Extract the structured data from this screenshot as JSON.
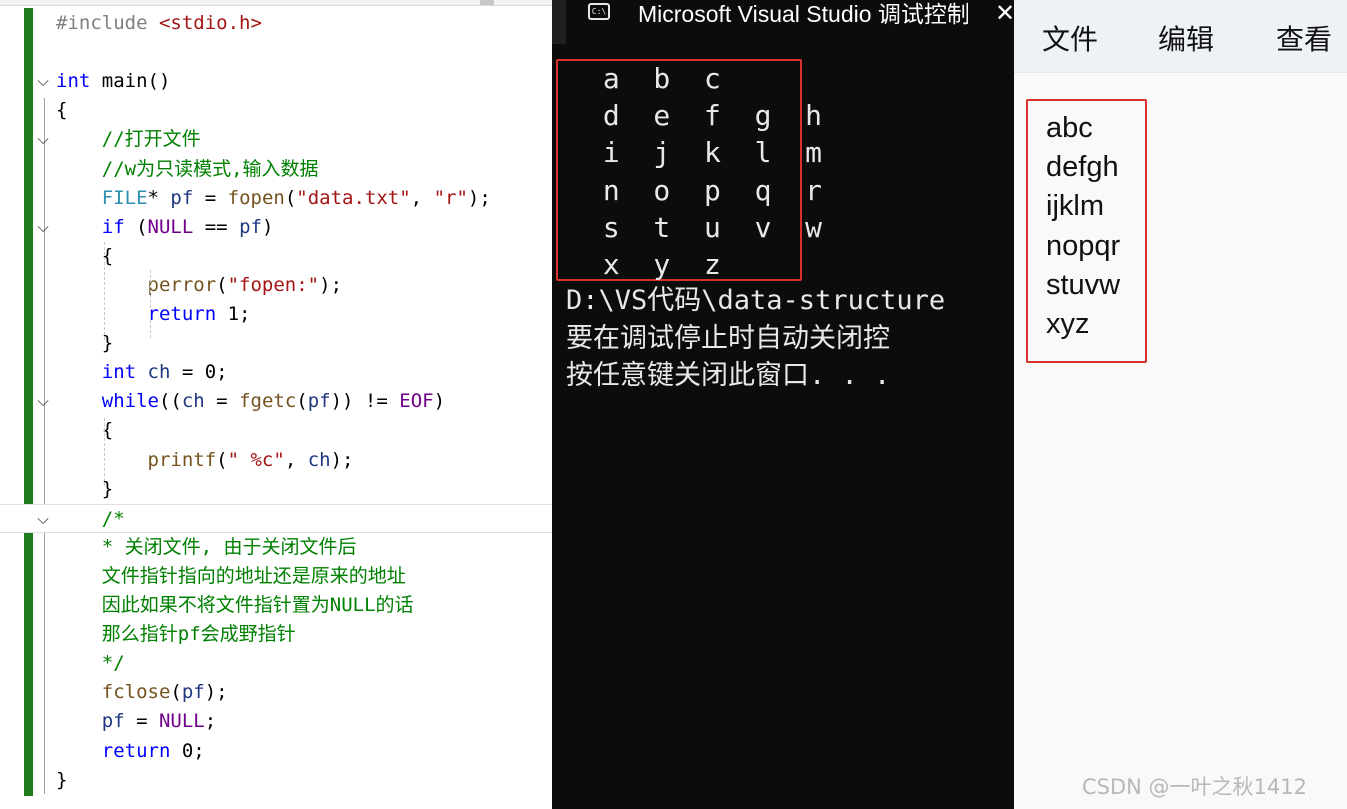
{
  "editor": {
    "lines": [
      [
        [
          "p",
          "#include "
        ],
        [
          "s",
          "<stdio.h>"
        ]
      ],
      [],
      [
        [
          "k",
          "int "
        ],
        [
          "",
          "main()"
        ]
      ],
      [
        [
          "",
          "{"
        ]
      ],
      [
        [
          "c",
          "    //打开文件"
        ]
      ],
      [
        [
          "c",
          "    //w为只读模式,输入数据"
        ]
      ],
      [
        [
          "t",
          "    FILE"
        ],
        [
          "",
          "* "
        ],
        [
          "v",
          "pf"
        ],
        [
          "",
          " = "
        ],
        [
          "f",
          "fopen"
        ],
        [
          "",
          "("
        ],
        [
          "s",
          "\"data.txt\""
        ],
        [
          "",
          ", "
        ],
        [
          "s",
          "\"r\""
        ],
        [
          "",
          ");"
        ]
      ],
      [
        [
          "k",
          "    if "
        ],
        [
          "",
          "("
        ],
        [
          "m",
          "NULL"
        ],
        [
          "",
          " == "
        ],
        [
          "v",
          "pf"
        ],
        [
          "",
          ")"
        ]
      ],
      [
        [
          "",
          "    {"
        ]
      ],
      [
        [
          "f",
          "        perror"
        ],
        [
          "",
          "("
        ],
        [
          "s",
          "\"fopen:\""
        ],
        [
          "",
          ");"
        ]
      ],
      [
        [
          "k",
          "        return "
        ],
        [
          "",
          "1;"
        ]
      ],
      [
        [
          "",
          "    }"
        ]
      ],
      [
        [
          "k",
          "    int "
        ],
        [
          "v",
          "ch"
        ],
        [
          "",
          " = 0;"
        ]
      ],
      [
        [
          "k",
          "    while"
        ],
        [
          "",
          "(("
        ],
        [
          "v",
          "ch"
        ],
        [
          "",
          " = "
        ],
        [
          "f",
          "fgetc"
        ],
        [
          "",
          "("
        ],
        [
          "v",
          "pf"
        ],
        [
          "",
          ")) != "
        ],
        [
          "m",
          "EOF"
        ],
        [
          "",
          ")"
        ]
      ],
      [
        [
          "",
          "    {"
        ]
      ],
      [
        [
          "f",
          "        printf"
        ],
        [
          "",
          "("
        ],
        [
          "s",
          "\" %c\""
        ],
        [
          "",
          ", "
        ],
        [
          "v",
          "ch"
        ],
        [
          "",
          ");"
        ]
      ],
      [
        [
          "",
          "    }"
        ]
      ],
      [
        [
          "c",
          "    /*"
        ]
      ],
      [
        [
          "c",
          "    * 关闭文件, 由于关闭文件后"
        ]
      ],
      [
        [
          "c",
          "    文件指针指向的地址还是原来的地址"
        ]
      ],
      [
        [
          "c",
          "    因此如果不将文件指针置为NULL的话"
        ]
      ],
      [
        [
          "c",
          "    那么指针pf会成野指针"
        ]
      ],
      [
        [
          "c",
          "    */"
        ]
      ],
      [
        [
          "f",
          "    fclose"
        ],
        [
          "",
          "("
        ],
        [
          "v",
          "pf"
        ],
        [
          "",
          ");"
        ]
      ],
      [
        [
          "v",
          "    pf"
        ],
        [
          "",
          " = "
        ],
        [
          "m",
          "NULL"
        ],
        [
          "",
          ";"
        ]
      ],
      [
        [
          "k",
          "    return "
        ],
        [
          "",
          "0;"
        ]
      ],
      [
        [
          "",
          "}"
        ]
      ]
    ]
  },
  "console": {
    "title": "Microsoft Visual Studio 调试控制台",
    "icon": "terminal-icon",
    "output_lines": [
      " a  b  c",
      " d  e  f  g  h",
      " i  j  k  l  m",
      " n  o  p  q  r",
      " s  t  u  v  w",
      " x  y  z"
    ],
    "message_lines": [
      "D:\\VS代码\\data-structure",
      "要在调试停止时自动关闭控",
      "按任意键关闭此窗口. . ."
    ]
  },
  "notepad": {
    "menu": [
      "文件",
      "编辑",
      "查看"
    ],
    "lines": [
      "abc",
      "defgh",
      "ijklm",
      "nopqr",
      "stuvw",
      "xyz"
    ]
  },
  "watermark": "CSDN @一叶之秋1412",
  "colors": {
    "highlight_box": "#d9312b",
    "change_bar": "#1e7b1e",
    "console_bg": "#0c0c0c"
  }
}
